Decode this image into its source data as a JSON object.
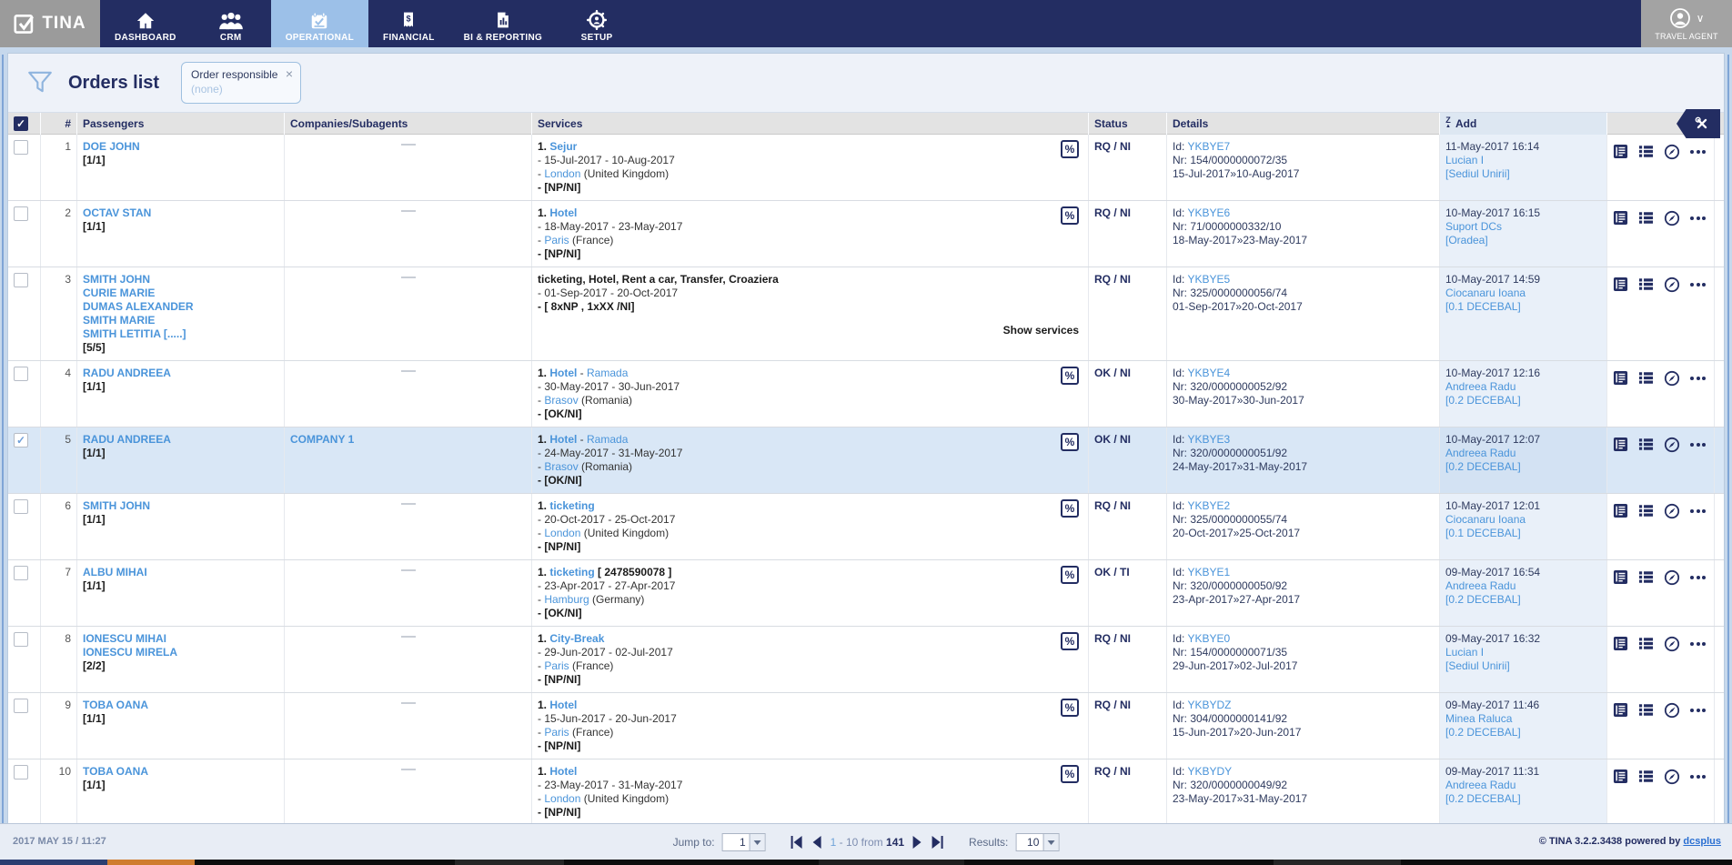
{
  "nav": {
    "brand": "TINA",
    "tabs": [
      {
        "label": "DASHBOARD",
        "icon": "home-icon",
        "active": false
      },
      {
        "label": "CRM",
        "icon": "people-icon",
        "active": false
      },
      {
        "label": "OPERATIONAL",
        "icon": "calendar-check-icon",
        "active": true
      },
      {
        "label": "FINANCIAL",
        "icon": "receipt-icon",
        "active": false
      },
      {
        "label": "BI & REPORTING",
        "icon": "report-chart-icon",
        "active": false
      },
      {
        "label": "SETUP",
        "icon": "gear-user-icon",
        "active": false
      }
    ],
    "user": {
      "label": "TRAVEL AGENT"
    }
  },
  "filter_bar": {
    "title": "Orders list",
    "chip": {
      "label": "Order responsible",
      "value": "(none)"
    }
  },
  "icons": {
    "check": "✓",
    "close": "×",
    "percent": "%",
    "sort_letter": "Z",
    "sort_arrow": "▲"
  },
  "table": {
    "headers": {
      "number_sign": "#",
      "passengers": "Passengers",
      "companies": "Companies/Subagents",
      "services": "Services",
      "status": "Status",
      "details": "Details",
      "add": "Add"
    },
    "labels": {
      "id_prefix": "Id:",
      "show_services": "Show services",
      "dash_prefix": "- "
    },
    "rows": [
      {
        "num": "1",
        "selected": false,
        "tall": false,
        "passengers": [
          "DOE JOHN"
        ],
        "pax_count": "[1/1]",
        "company": null,
        "service": {
          "prefix": "1.",
          "name": "Sejur",
          "suffix": "",
          "extra": "",
          "dates": "- 15-Jul-2017 - 10-Aug-2017",
          "city": "London",
          "country": "(United Kingdom)",
          "tag": "- [NP/NI]",
          "percent": true,
          "plain_title": null,
          "show_services": false
        },
        "status": "RQ / NI",
        "details": {
          "id": "YKBYE7",
          "nr": "Nr: 154/0000000072/35",
          "range": "15-Jul-2017»10-Aug-2017"
        },
        "add": {
          "date": "11-May-2017 16:14",
          "user": "Lucian I",
          "loc": "[Sediul Unirii]"
        }
      },
      {
        "num": "2",
        "selected": false,
        "tall": false,
        "passengers": [
          "OCTAV STAN"
        ],
        "pax_count": "[1/1]",
        "company": null,
        "service": {
          "prefix": "1.",
          "name": "Hotel",
          "suffix": "",
          "extra": "",
          "dates": "- 18-May-2017 - 23-May-2017",
          "city": "Paris",
          "country": "(France)",
          "tag": "- [NP/NI]",
          "percent": true,
          "plain_title": null,
          "show_services": false
        },
        "status": "RQ / NI",
        "details": {
          "id": "YKBYE6",
          "nr": "Nr: 71/0000000332/10",
          "range": "18-May-2017»23-May-2017"
        },
        "add": {
          "date": "10-May-2017 16:15",
          "user": "Suport DCs",
          "loc": "[Oradea]"
        }
      },
      {
        "num": "3",
        "selected": false,
        "tall": true,
        "passengers": [
          "SMITH JOHN",
          "CURIE MARIE",
          "DUMAS ALEXANDER",
          "SMITH MARIE",
          "SMITH LETITIA [.....]"
        ],
        "pax_count": "[5/5]",
        "company": null,
        "service": {
          "prefix": "",
          "name": "",
          "suffix": "",
          "extra": "",
          "dates": "- 01-Sep-2017 - 20-Oct-2017",
          "city": null,
          "country": "",
          "tag": "- [ 8xNP , 1xXX /NI]",
          "percent": false,
          "plain_title": "ticketing, Hotel, Rent a car, Transfer, Croaziera",
          "show_services": true
        },
        "status": "RQ / NI",
        "details": {
          "id": "YKBYE5",
          "nr": "Nr: 325/0000000056/74",
          "range": "01-Sep-2017»20-Oct-2017"
        },
        "add": {
          "date": "10-May-2017 14:59",
          "user": "Ciocanaru Ioana",
          "loc": "[0.1 DECEBAL]"
        }
      },
      {
        "num": "4",
        "selected": false,
        "tall": false,
        "passengers": [
          "RADU ANDREEA"
        ],
        "pax_count": "[1/1]",
        "company": null,
        "service": {
          "prefix": "1.",
          "name": "Hotel",
          "suffix": "",
          "extra": "Ramada",
          "dates": "- 30-May-2017 - 30-Jun-2017",
          "city": "Brasov",
          "country": "(Romania)",
          "tag": "- [OK/NI]",
          "percent": true,
          "plain_title": null,
          "show_services": false
        },
        "status": "OK / NI",
        "details": {
          "id": "YKBYE4",
          "nr": "Nr: 320/0000000052/92",
          "range": "30-May-2017»30-Jun-2017"
        },
        "add": {
          "date": "10-May-2017 12:16",
          "user": "Andreea Radu",
          "loc": "[0.2 DECEBAL]"
        }
      },
      {
        "num": "5",
        "selected": true,
        "tall": false,
        "passengers": [
          "RADU ANDREEA"
        ],
        "pax_count": "[1/1]",
        "company": "COMPANY 1",
        "service": {
          "prefix": "1.",
          "name": "Hotel",
          "suffix": "",
          "extra": "Ramada",
          "dates": "- 24-May-2017 - 31-May-2017",
          "city": "Brasov",
          "country": "(Romania)",
          "tag": "- [OK/NI]",
          "percent": true,
          "plain_title": null,
          "show_services": false
        },
        "status": "OK / NI",
        "details": {
          "id": "YKBYE3",
          "nr": "Nr: 320/0000000051/92",
          "range": "24-May-2017»31-May-2017"
        },
        "add": {
          "date": "10-May-2017 12:07",
          "user": "Andreea Radu",
          "loc": "[0.2 DECEBAL]"
        }
      },
      {
        "num": "6",
        "selected": false,
        "tall": false,
        "passengers": [
          "SMITH JOHN"
        ],
        "pax_count": "[1/1]",
        "company": null,
        "service": {
          "prefix": "1.",
          "name": "ticketing",
          "suffix": "",
          "extra": "",
          "dates": "- 20-Oct-2017 - 25-Oct-2017",
          "city": "London",
          "country": "(United Kingdom)",
          "tag": "- [NP/NI]",
          "percent": true,
          "plain_title": null,
          "show_services": false
        },
        "status": "RQ / NI",
        "details": {
          "id": "YKBYE2",
          "nr": "Nr: 325/0000000055/74",
          "range": "20-Oct-2017»25-Oct-2017"
        },
        "add": {
          "date": "10-May-2017 12:01",
          "user": "Ciocanaru Ioana",
          "loc": "[0.1 DECEBAL]"
        }
      },
      {
        "num": "7",
        "selected": false,
        "tall": false,
        "passengers": [
          "ALBU MIHAI"
        ],
        "pax_count": "[1/1]",
        "company": null,
        "service": {
          "prefix": "1.",
          "name": "ticketing",
          "suffix": " [ 2478590078 ]",
          "extra": "",
          "dates": "- 23-Apr-2017 - 27-Apr-2017",
          "city": "Hamburg",
          "country": "(Germany)",
          "tag": "- [OK/NI]",
          "percent": true,
          "plain_title": null,
          "show_services": false
        },
        "status": "OK / TI",
        "details": {
          "id": "YKBYE1",
          "nr": "Nr: 320/0000000050/92",
          "range": "23-Apr-2017»27-Apr-2017"
        },
        "add": {
          "date": "09-May-2017 16:54",
          "user": "Andreea Radu",
          "loc": "[0.2 DECEBAL]"
        }
      },
      {
        "num": "8",
        "selected": false,
        "tall": false,
        "passengers": [
          "IONESCU MIHAI",
          "IONESCU MIRELA"
        ],
        "pax_count": "[2/2]",
        "company": null,
        "service": {
          "prefix": "1.",
          "name": "City-Break",
          "suffix": "",
          "extra": "",
          "dates": "- 29-Jun-2017 - 02-Jul-2017",
          "city": "Paris",
          "country": "(France)",
          "tag": "- [NP/NI]",
          "percent": true,
          "plain_title": null,
          "show_services": false
        },
        "status": "RQ / NI",
        "details": {
          "id": "YKBYE0",
          "nr": "Nr: 154/0000000071/35",
          "range": "29-Jun-2017»02-Jul-2017"
        },
        "add": {
          "date": "09-May-2017 16:32",
          "user": "Lucian I",
          "loc": "[Sediul Unirii]"
        }
      },
      {
        "num": "9",
        "selected": false,
        "tall": false,
        "passengers": [
          "TOBA OANA"
        ],
        "pax_count": "[1/1]",
        "company": null,
        "service": {
          "prefix": "1.",
          "name": "Hotel",
          "suffix": "",
          "extra": "",
          "dates": "- 15-Jun-2017 - 20-Jun-2017",
          "city": "Paris",
          "country": "(France)",
          "tag": "- [NP/NI]",
          "percent": true,
          "plain_title": null,
          "show_services": false
        },
        "status": "RQ / NI",
        "details": {
          "id": "YKBYDZ",
          "nr": "Nr: 304/0000000141/92",
          "range": "15-Jun-2017»20-Jun-2017"
        },
        "add": {
          "date": "09-May-2017 11:46",
          "user": "Minea Raluca",
          "loc": "[0.2 DECEBAL]"
        }
      },
      {
        "num": "10",
        "selected": false,
        "tall": false,
        "passengers": [
          "TOBA OANA"
        ],
        "pax_count": "[1/1]",
        "company": null,
        "service": {
          "prefix": "1.",
          "name": "Hotel",
          "suffix": "",
          "extra": "",
          "dates": "- 23-May-2017 - 31-May-2017",
          "city": "London",
          "country": "(United Kingdom)",
          "tag": "- [NP/NI]",
          "percent": true,
          "plain_title": null,
          "show_services": false
        },
        "status": "RQ / NI",
        "details": {
          "id": "YKBYDY",
          "nr": "Nr: 320/0000000049/92",
          "range": "23-May-2017»31-May-2017"
        },
        "add": {
          "date": "09-May-2017 11:31",
          "user": "Andreea Radu",
          "loc": "[0.2 DECEBAL]"
        }
      }
    ]
  },
  "footer": {
    "datetime": "2017 MAY 15 / 11:27",
    "jump_label": "Jump to:",
    "jump_value": "1",
    "range_current": "1",
    "range_rest": "- 10 from",
    "range_total": "141",
    "results_label": "Results:",
    "results_value": "10",
    "copyright": "© TINA 3.2.2.3438 powered by",
    "brand_link": "dcsplus"
  }
}
